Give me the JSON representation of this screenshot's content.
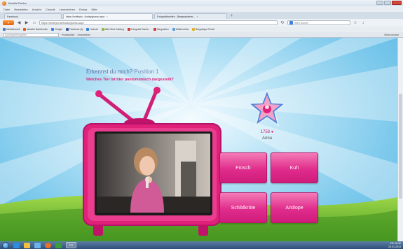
{
  "window": {
    "title": "Mozilla Firefox"
  },
  "menu": [
    "Datei",
    "Bearbeiten",
    "Ansicht",
    "Chronik",
    "Lesezeichen",
    "Extras",
    "Hilfe"
  ],
  "tabs": [
    {
      "label": "Facebook",
      "active": false
    },
    {
      "label": "https://smileytv.../today/guess.aspx",
      "active": true
    },
    {
      "label": "Fotografieseiten - Bergwanderer...",
      "active": false
    }
  ],
  "nav": {
    "url": "https://smileytv.de/today/guess.aspx",
    "search_placeholder": "Web Suche"
  },
  "bookmarks": [
    {
      "label": "Meistbesucht",
      "color": "#4a78c8"
    },
    {
      "label": "aktuelle Nachrichten",
      "color": "#e05a1e"
    },
    {
      "label": "Google",
      "color": "#3b82e0"
    },
    {
      "label": "Facebook (4)",
      "color": "#3b5998"
    },
    {
      "label": "Hotmail",
      "color": "#2f7fd6"
    },
    {
      "label": "Web Slice-Katalog",
      "color": "#8fb84a"
    },
    {
      "label": "Fotografie Sachs...",
      "color": "#d03a3a"
    },
    {
      "label": "Bergwelten",
      "color": "#d03a3a"
    },
    {
      "label": "Wetteronline",
      "color": "#5aa0d8"
    },
    {
      "label": "Bergsteiger-Portal",
      "color": "#e0b020"
    }
  ],
  "addon": {
    "search_placeholder": "Suchbegriff eingeben",
    "items": [
      "Privatsphäre",
      "Lesezeichen",
      "Meine Ansicht"
    ]
  },
  "page": {
    "question_title": "Erkennst du mich?",
    "question_number": "Position 1",
    "question_sub": "Welches Tier ist hier pantomimisch dargestellt?",
    "score": "1758",
    "player": "Anna"
  },
  "answers": [
    {
      "label": "Frosch"
    },
    {
      "label": "Kuh"
    },
    {
      "label": "Schildkröte"
    },
    {
      "label": "Antilope"
    }
  ],
  "taskbar": {
    "apps": [
      "FS"
    ],
    "time": "16:42",
    "date": "24.01.2013",
    "lang": "DE"
  }
}
